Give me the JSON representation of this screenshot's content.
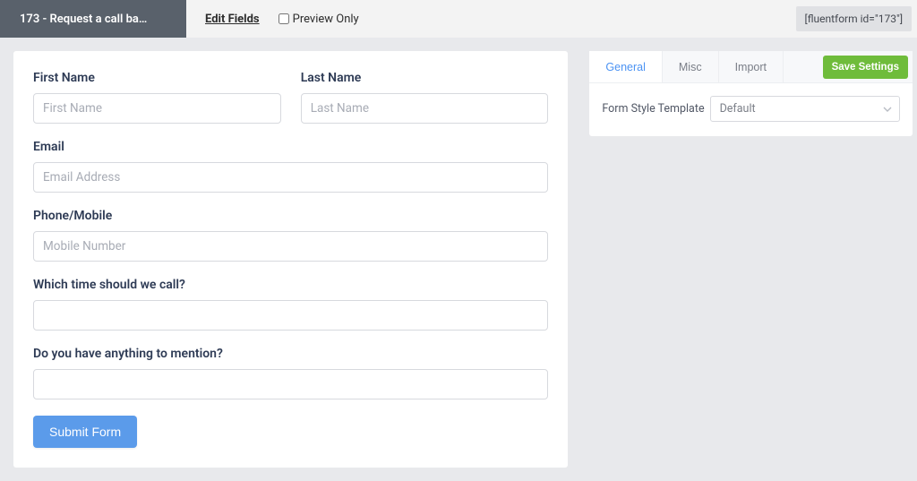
{
  "topbar": {
    "form_title": "173 - Request a call ba…",
    "edit_fields": "Edit Fields",
    "preview_only": "Preview Only",
    "shortcode": "[fluentform id=\"173\"]"
  },
  "form": {
    "first_name": {
      "label": "First Name",
      "placeholder": "First Name"
    },
    "last_name": {
      "label": "Last Name",
      "placeholder": "Last Name"
    },
    "email": {
      "label": "Email",
      "placeholder": "Email Address"
    },
    "phone": {
      "label": "Phone/Mobile",
      "placeholder": "Mobile Number"
    },
    "call_time": {
      "label": "Which time should we call?",
      "placeholder": ""
    },
    "message": {
      "label": "Do you have anything to mention?",
      "placeholder": ""
    },
    "submit": "Submit Form"
  },
  "side": {
    "tabs": {
      "general": "General",
      "misc": "Misc",
      "import": "Import"
    },
    "save": "Save Settings",
    "style_label": "Form Style Template",
    "style_value": "Default"
  }
}
